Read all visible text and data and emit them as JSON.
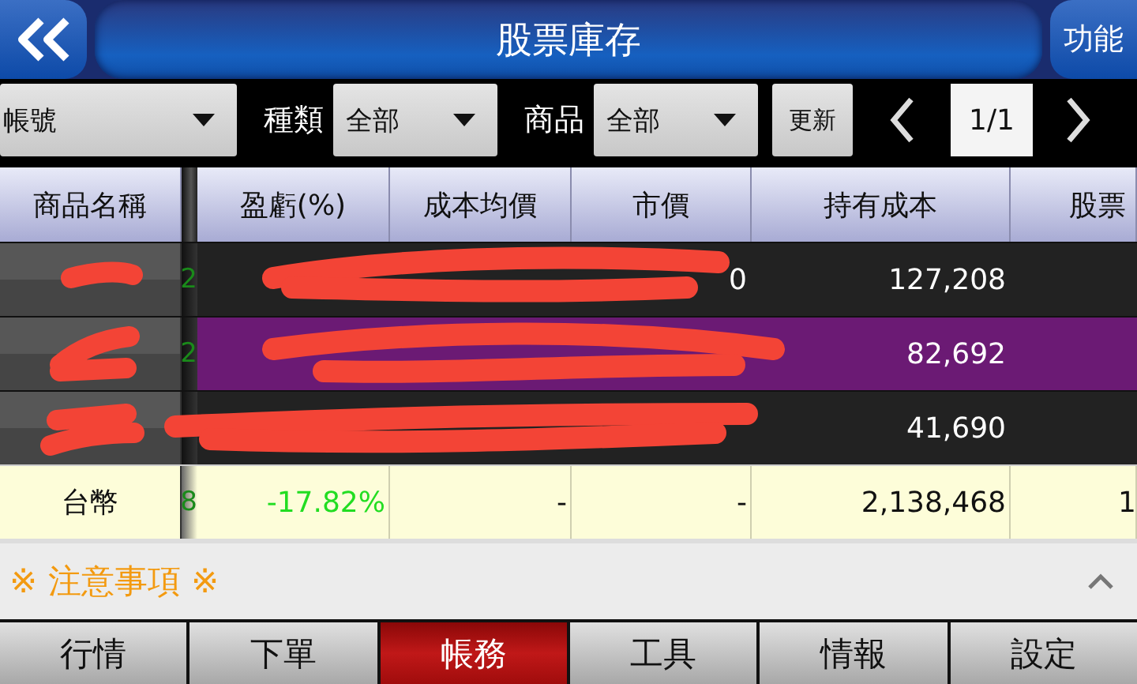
{
  "header": {
    "title": "股票庫存",
    "function_button": "功能"
  },
  "filters": {
    "account": {
      "value": "帳號"
    },
    "type": {
      "label": "種類",
      "value": "全部"
    },
    "product": {
      "label": "商品",
      "value": "全部"
    },
    "refresh_button": "更新",
    "page": "1/1"
  },
  "table": {
    "columns": [
      "商品名稱",
      "盈虧(%)",
      "成本均價",
      "市價",
      "持有成本",
      "股票"
    ],
    "rows": [
      {
        "kind": "holding",
        "selected": false,
        "redacted": true,
        "column_2": "2",
        "market_price": "0",
        "holding_cost": "127,208"
      },
      {
        "kind": "holding",
        "selected": true,
        "redacted": true,
        "column_2": "2",
        "holding_cost": "82,692"
      },
      {
        "kind": "holding",
        "selected": false,
        "redacted": true,
        "holding_cost": "41,690"
      },
      {
        "kind": "total",
        "selected": false,
        "redacted": false,
        "name": "台幣",
        "column_2": "8",
        "pnl": "-17.82%",
        "avg_cost": "-",
        "market_price": "-",
        "holding_cost": "2,138,468",
        "column_7": "1"
      }
    ]
  },
  "notice": {
    "text": "※ 注意事項 ※"
  },
  "tabs": [
    {
      "label": "行情",
      "selected": false
    },
    {
      "label": "下單",
      "selected": false
    },
    {
      "label": "帳務",
      "selected": true
    },
    {
      "label": "工具",
      "selected": false
    },
    {
      "label": "情報",
      "selected": false
    },
    {
      "label": "設定",
      "selected": false
    }
  ]
}
